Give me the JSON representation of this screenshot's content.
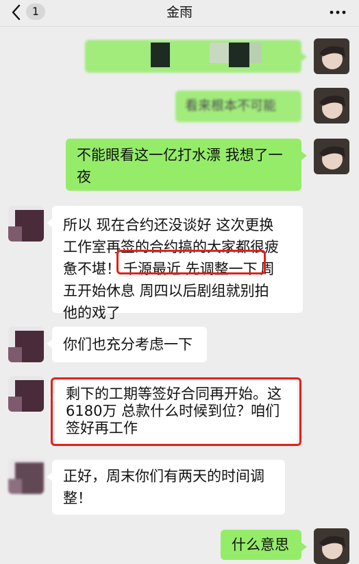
{
  "header": {
    "back_badge": "1",
    "title": "金雨",
    "more": "···"
  },
  "messages": [
    {
      "from": "me",
      "text": "（已打码）"
    },
    {
      "from": "me",
      "text": "看来根本不可能"
    },
    {
      "from": "me",
      "lines": [
        "不能眼看这一亿打水漂 我想了一",
        "夜"
      ]
    },
    {
      "from": "them",
      "lines_html_parts": {
        "l1": "所以 现在合约还没谈好 这次更换",
        "l2": "工作室再签的合约搞的大家都很疲",
        "l3a": "惫不堪！",
        "l3b": "千源最近 先调整一下",
        "l3c": "周",
        "l4": "五开始休息 周四以后剧组就别拍",
        "l5": "他的戏了"
      }
    },
    {
      "from": "them",
      "text": "你们也充分考虑一下"
    },
    {
      "from": "them",
      "lines": [
        "剩下的工期等签好合同再开始。这",
        "6180万 总款什么时候到位？咱们",
        "签好再工作"
      ]
    },
    {
      "from": "them",
      "lines": [
        "正好，周末你们有两天的时间调",
        "整！"
      ]
    },
    {
      "from": "me",
      "text": "什么意思"
    }
  ],
  "colors": {
    "background": "#ededed",
    "my_bubble": "#95ec69",
    "their_bubble": "#ffffff",
    "highlight": "#e0211b"
  }
}
